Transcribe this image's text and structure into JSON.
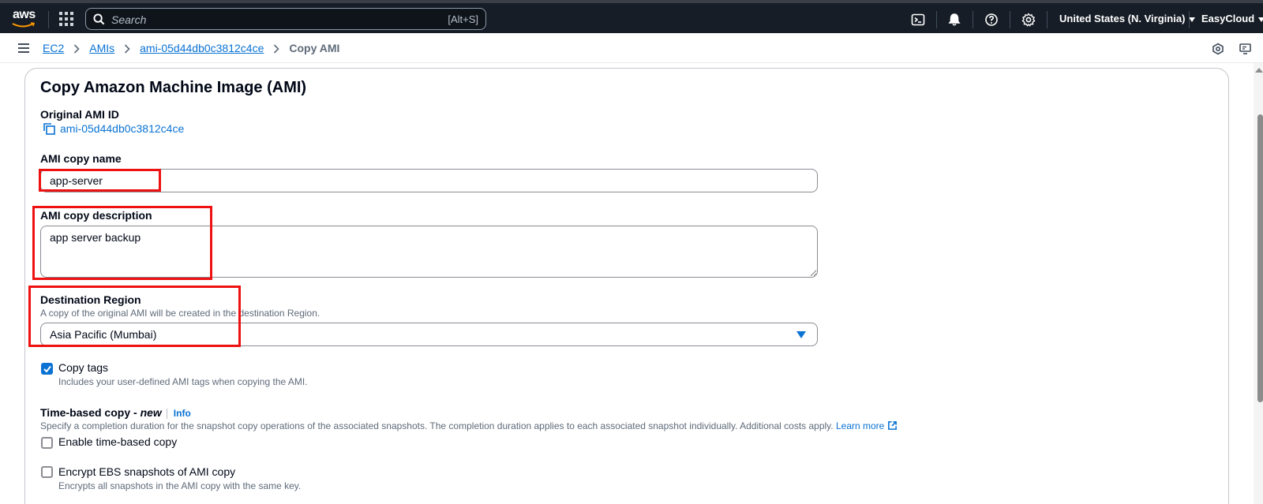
{
  "topnav": {
    "logo_text": "aws",
    "search_placeholder": "Search",
    "search_shortcut": "[Alt+S]",
    "region": "United States (N. Virginia)",
    "account": "EasyCloud",
    "icons": [
      "services-grid-icon",
      "cloudshell-icon",
      "bell-icon",
      "help-icon",
      "gear-icon"
    ]
  },
  "breadcrumb": {
    "items": [
      "EC2",
      "AMIs",
      "ami-05d44db0c3812c4ce"
    ],
    "current": "Copy AMI"
  },
  "form": {
    "title": "Copy Amazon Machine Image (AMI)",
    "original_ami": {
      "label": "Original AMI ID",
      "value": "ami-05d44db0c3812c4ce"
    },
    "copy_name": {
      "label": "AMI copy name",
      "value": "app-server"
    },
    "copy_description": {
      "label": "AMI copy description",
      "value": "app server backup"
    },
    "destination_region": {
      "label": "Destination Region",
      "description": "A copy of the original AMI will be created in the destination Region.",
      "value": "Asia Pacific (Mumbai)"
    },
    "copy_tags": {
      "label": "Copy tags",
      "description": "Includes your user-defined AMI tags when copying the AMI.",
      "checked": true
    },
    "time_based": {
      "label_prefix": "Time-based copy - ",
      "label_new": "new",
      "info": "Info",
      "description": "Specify a completion duration for the snapshot copy operations of the associated snapshots. The completion duration applies to each associated snapshot individually. Additional costs apply.",
      "learn_more": "Learn more",
      "checkbox_label": "Enable time-based copy",
      "checked": false
    },
    "encrypt": {
      "label": "Encrypt EBS snapshots of AMI copy",
      "description": "Encrypts all snapshots in the AMI copy with the same key.",
      "checked": false
    }
  },
  "colors": {
    "nav_bg": "#161d26",
    "link": "#0972d3",
    "annotation": "#ee1111"
  }
}
